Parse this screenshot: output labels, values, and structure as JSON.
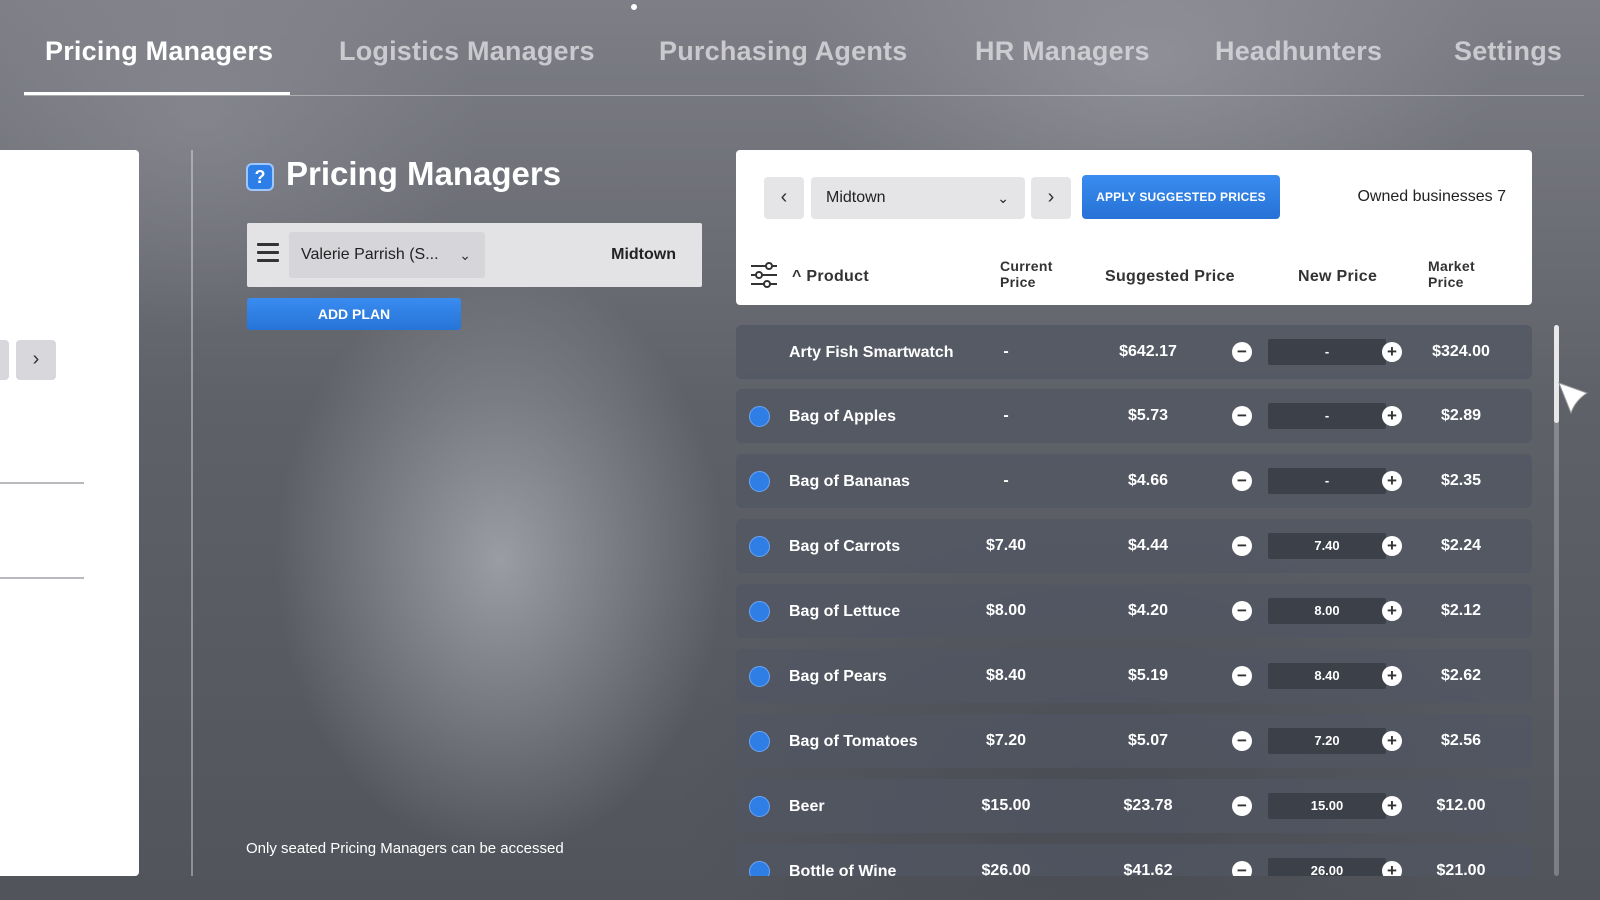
{
  "tabs": [
    {
      "label": "Pricing Managers",
      "active": true
    },
    {
      "label": "Logistics Managers",
      "active": false
    },
    {
      "label": "Purchasing Agents",
      "active": false
    },
    {
      "label": "HR Managers",
      "active": false
    },
    {
      "label": "Headhunters",
      "active": false
    },
    {
      "label": "Settings",
      "active": false
    }
  ],
  "left_panel": {
    "next_icon": "chevron-right-icon"
  },
  "section": {
    "title": "Pricing Managers",
    "help_label": "?",
    "plan": {
      "manager": "Valerie Parrish (S...",
      "location": "Midtown"
    },
    "add_plan_label": "ADD PLAN",
    "note": "Only seated Pricing Managers can be accessed"
  },
  "header": {
    "location": "Midtown",
    "apply_label": "APPLY SUGGESTED PRICES",
    "owned": "Owned businesses 7",
    "columns": {
      "product": "Product",
      "current": "Current Price",
      "suggested": "Suggested Price",
      "new": "New Price",
      "market": "Market Price"
    }
  },
  "products": [
    {
      "name": "Arty Fish Smartwatch",
      "current": "-",
      "suggested": "$642.17",
      "new": "-",
      "market": "$324.00",
      "selected": false
    },
    {
      "name": "Bag of Apples",
      "current": "-",
      "suggested": "$5.73",
      "new": "-",
      "market": "$2.89",
      "selected": true
    },
    {
      "name": "Bag of Bananas",
      "current": "-",
      "suggested": "$4.66",
      "new": "-",
      "market": "$2.35",
      "selected": true
    },
    {
      "name": "Bag of Carrots",
      "current": "$7.40",
      "suggested": "$4.44",
      "new": "7.40",
      "market": "$2.24",
      "selected": true
    },
    {
      "name": "Bag of Lettuce",
      "current": "$8.00",
      "suggested": "$4.20",
      "new": "8.00",
      "market": "$2.12",
      "selected": true
    },
    {
      "name": "Bag of Pears",
      "current": "$8.40",
      "suggested": "$5.19",
      "new": "8.40",
      "market": "$2.62",
      "selected": true
    },
    {
      "name": "Bag of Tomatoes",
      "current": "$7.20",
      "suggested": "$5.07",
      "new": "7.20",
      "market": "$2.56",
      "selected": true
    },
    {
      "name": "Beer",
      "current": "$15.00",
      "suggested": "$23.78",
      "new": "15.00",
      "market": "$12.00",
      "selected": true
    },
    {
      "name": "Bottle of Wine",
      "current": "$26.00",
      "suggested": "$41.62",
      "new": "26.00",
      "market": "$21.00",
      "selected": true
    }
  ],
  "colors": {
    "accent": "#2f7ee6",
    "row_bg": "#505662"
  }
}
